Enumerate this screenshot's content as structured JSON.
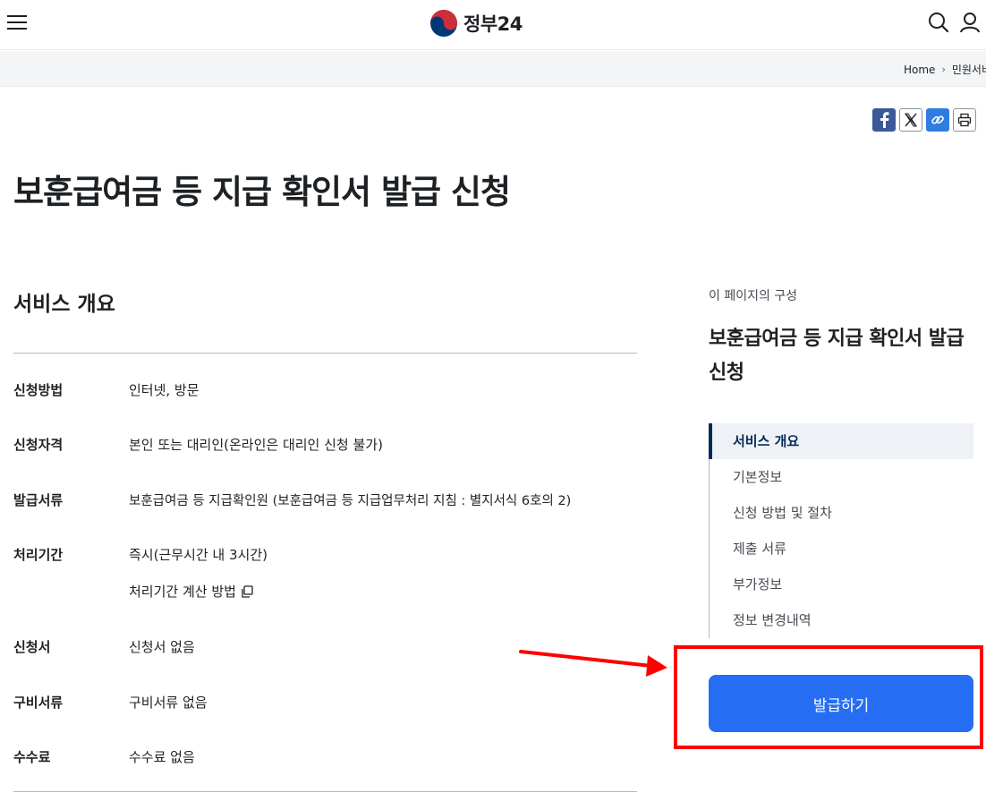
{
  "header": {
    "logo_text": "정부24",
    "menu_icon": "hamburger-menu-icon",
    "search_icon": "search-icon",
    "user_icon": "user-icon"
  },
  "breadcrumb": {
    "home": "Home",
    "current": "민원서비"
  },
  "share": {
    "icons": [
      "facebook-icon",
      "x-twitter-icon",
      "link-icon",
      "print-icon"
    ]
  },
  "page_title": "보훈급여금 등 지급 확인서 발급 신청",
  "overview": {
    "title": "서비스 개요",
    "rows": [
      {
        "label": "신청방법",
        "value": "인터넷, 방문"
      },
      {
        "label": "신청자격",
        "value": "본인 또는 대리인(온라인은 대리인 신청 불가)"
      },
      {
        "label": "발급서류",
        "value": "보훈급여금 등 지급확인원 (보훈급여금 등 지급업무처리 지침 : 별지서식 6호의 2)"
      },
      {
        "label": "처리기간",
        "value": "즉시(근무시간 내 3시간)"
      },
      {
        "label": "신청서",
        "value": "신청서 없음"
      },
      {
        "label": "구비서류",
        "value": "구비서류 없음"
      },
      {
        "label": "수수료",
        "value": "수수료 없음"
      }
    ],
    "calc_link": "처리기간 계산 방법"
  },
  "sidebar": {
    "caption": "이 페이지의 구성",
    "title": "보훈급여금 등 지급 확인서 발급 신청",
    "items": [
      {
        "label": "서비스 개요",
        "active": true
      },
      {
        "label": "기본정보"
      },
      {
        "label": "신청 방법 및 절차"
      },
      {
        "label": "제출 서류"
      },
      {
        "label": "부가정보"
      },
      {
        "label": "정보 변경내역"
      }
    ]
  },
  "action": {
    "issue_label": "발급하기"
  },
  "colors": {
    "primary_button": "#256ef4",
    "annotation_red": "#ff0000",
    "active_nav": "#052b57"
  }
}
